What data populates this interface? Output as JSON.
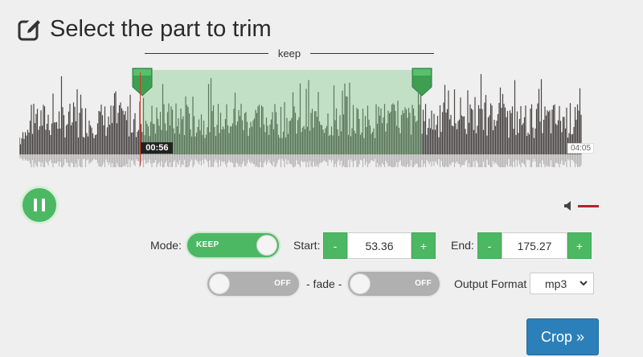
{
  "header": {
    "title": "Select the part to trim",
    "icon": "edit-icon"
  },
  "selection_label": "keep",
  "player": {
    "current_time": "00:56",
    "total_time": "04:05",
    "play_state_icon": "pause-icon",
    "selection_start_fraction": 0.218,
    "selection_end_fraction": 0.716,
    "cursor_fraction": 0.229
  },
  "volume": {
    "icon": "speaker-icon",
    "level": 1.0
  },
  "mode": {
    "label": "Mode:",
    "toggle_text": "KEEP",
    "state": "on"
  },
  "start": {
    "label": "Start:",
    "value": "53.36",
    "minus": "-",
    "plus": "+"
  },
  "end": {
    "label": "End:",
    "value": "175.27",
    "minus": "-",
    "plus": "+"
  },
  "fade": {
    "label": "- fade -",
    "fade_in_text": "OFF",
    "fade_out_text": "OFF"
  },
  "output": {
    "label": "Output Format",
    "selected": "mp3"
  },
  "crop_button": {
    "label": "Crop »"
  },
  "colors": {
    "accent_green": "#4cb863",
    "crop_blue": "#2c80b9",
    "waveform": "#4a4545",
    "cursor_red": "#d13b2a"
  }
}
